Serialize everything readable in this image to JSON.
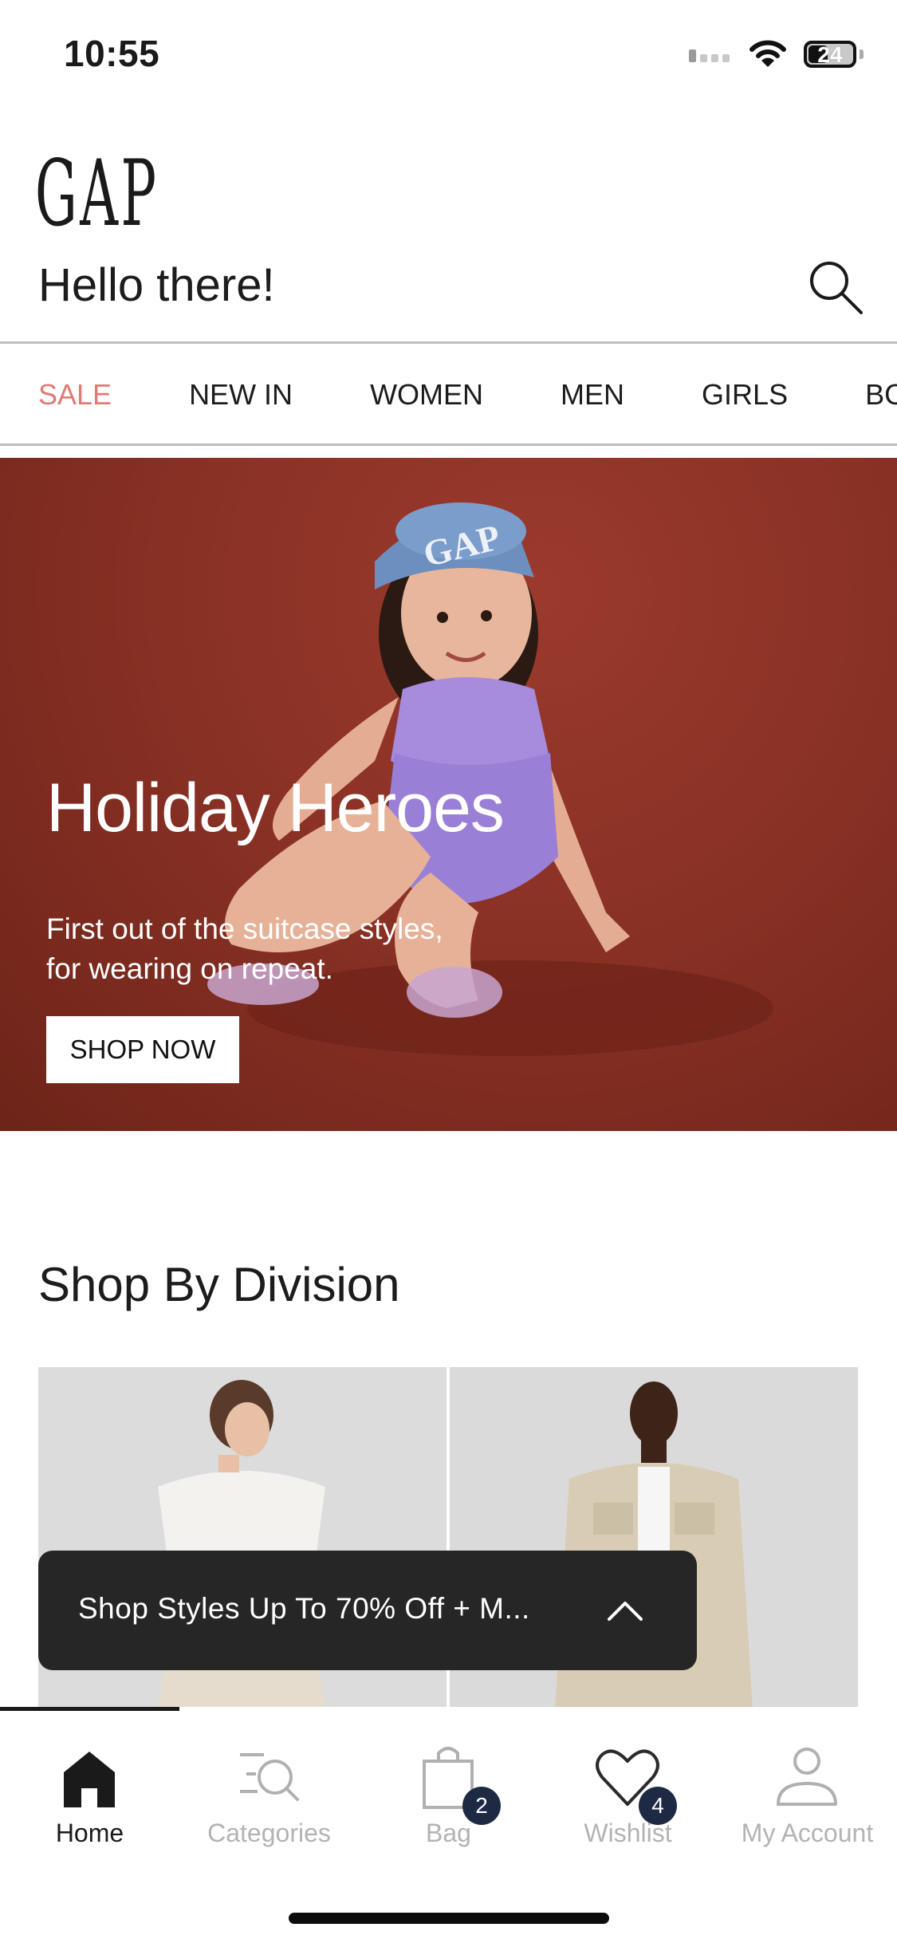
{
  "status_bar": {
    "time": "10:55",
    "battery_level": "24"
  },
  "header": {
    "logo": "GAP",
    "greeting": "Hello there!",
    "search_icon": "search-icon"
  },
  "nav": {
    "items": [
      {
        "label": "SALE"
      },
      {
        "label": "NEW IN"
      },
      {
        "label": "WOMEN"
      },
      {
        "label": "MEN"
      },
      {
        "label": "GIRLS"
      },
      {
        "label": "BC"
      }
    ]
  },
  "hero": {
    "title": "Holiday Heroes",
    "subtitle_line1": "First out of the suitcase styles,",
    "subtitle_line2": "for wearing on repeat.",
    "cta": "SHOP NOW",
    "cap_text": "GAP"
  },
  "shop_by_division": {
    "title": "Shop By Division"
  },
  "promo": {
    "text": "Shop Styles Up To 70% Off + M..."
  },
  "tabbar": {
    "tabs": [
      {
        "label": "Home",
        "icon": "home-icon"
      },
      {
        "label": "Categories",
        "icon": "categories-icon"
      },
      {
        "label": "Bag",
        "icon": "bag-icon",
        "badge": "2"
      },
      {
        "label": "Wishlist",
        "icon": "heart-icon",
        "badge": "4"
      },
      {
        "label": "My Account",
        "icon": "account-icon"
      }
    ]
  },
  "colors": {
    "sale": "#e07a74",
    "hero_bg": "#8a3125",
    "badge": "#1e2a44",
    "promo_bg": "#262626"
  }
}
